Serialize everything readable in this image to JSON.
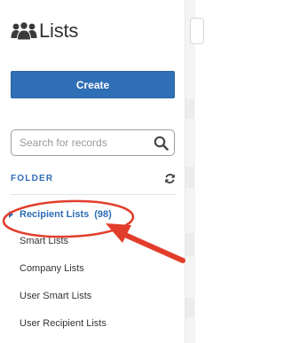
{
  "header": {
    "icon": "users-icon",
    "title": "Lists"
  },
  "create_button": {
    "label": "Create",
    "color": "#2f6fb5"
  },
  "search": {
    "placeholder": "Search for records",
    "value": ""
  },
  "folder": {
    "label": "FOLDER",
    "refresh_icon": "refresh-icon",
    "items": [
      {
        "label": "Recipient Lists",
        "count": "(98)",
        "active": true
      },
      {
        "label": "Smart Lists"
      },
      {
        "label": "Company Lists"
      },
      {
        "label": "User Smart Lists"
      },
      {
        "label": "User Recipient Lists"
      }
    ]
  },
  "annotation": {
    "shapes": [
      "red-ellipse-highlight",
      "red-arrow"
    ],
    "color": "#e23d2b"
  },
  "accent_color": "#2d6db5"
}
